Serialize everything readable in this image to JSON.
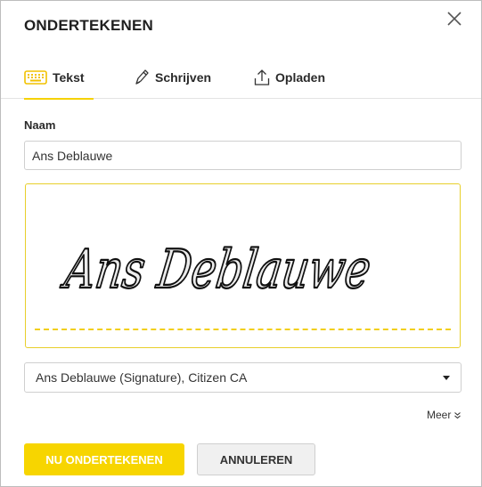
{
  "dialog": {
    "title": "ONDERTEKENEN",
    "close_icon": "close-icon"
  },
  "tabs": [
    {
      "label": "Tekst",
      "icon": "keyboard-icon",
      "active": true
    },
    {
      "label": "Schrijven",
      "icon": "pen-icon",
      "active": false
    },
    {
      "label": "Opladen",
      "icon": "upload-icon",
      "active": false
    }
  ],
  "form": {
    "name_label": "Naam",
    "name_value": "Ans Deblauwe",
    "signature_preview_text": "Ans Deblauwe",
    "certificate_selected": "Ans Deblauwe (Signature), Citizen CA",
    "more_label": "Meer"
  },
  "actions": {
    "sign_label": "NU ONDERTEKENEN",
    "cancel_label": "ANNULEREN"
  },
  "colors": {
    "accent": "#f7d500",
    "signature_border": "#e8cf2b",
    "baseline": "#f2cf1c"
  }
}
